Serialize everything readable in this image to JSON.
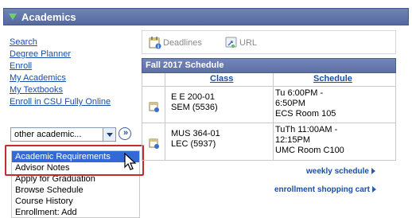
{
  "header": {
    "title": "Academics"
  },
  "nav": {
    "links": [
      "Search",
      "Degree Planner",
      "Enroll",
      "My Academics",
      "My Textbooks",
      "Enroll in CSU Fully Online"
    ]
  },
  "select": {
    "value": "other academic...",
    "go_label": "»"
  },
  "dropdown": {
    "items": [
      "Academic Requirements",
      "Advisor Notes",
      "Apply for Graduation",
      "Browse Schedule",
      "Course History",
      "Enrollment: Add"
    ],
    "selected_index": 0
  },
  "toolbar": {
    "deadlines": "Deadlines",
    "url": "URL"
  },
  "schedule": {
    "title": "Fall 2017 Schedule",
    "columns": [
      "Class",
      "Schedule"
    ],
    "rows": [
      {
        "class_line1": "E E 200-01",
        "class_line2": "SEM (5536)",
        "sched_line1": "Tu 6:00PM -",
        "sched_line2": "6:50PM",
        "sched_line3": "ECS  Room 105"
      },
      {
        "class_line1": "MUS 364-01",
        "class_line2": "LEC (5937)",
        "sched_line1": "TuTh 11:00AM -",
        "sched_line2": "12:15PM",
        "sched_line3": "UMC  Room C100"
      }
    ]
  },
  "links": {
    "weekly": "weekly schedule",
    "cart": "enrollment shopping cart"
  },
  "colors": {
    "header_bg": "#5d70a5",
    "link": "#1a4ea8",
    "selection": "#3369d5",
    "highlight": "#c42b2b"
  }
}
